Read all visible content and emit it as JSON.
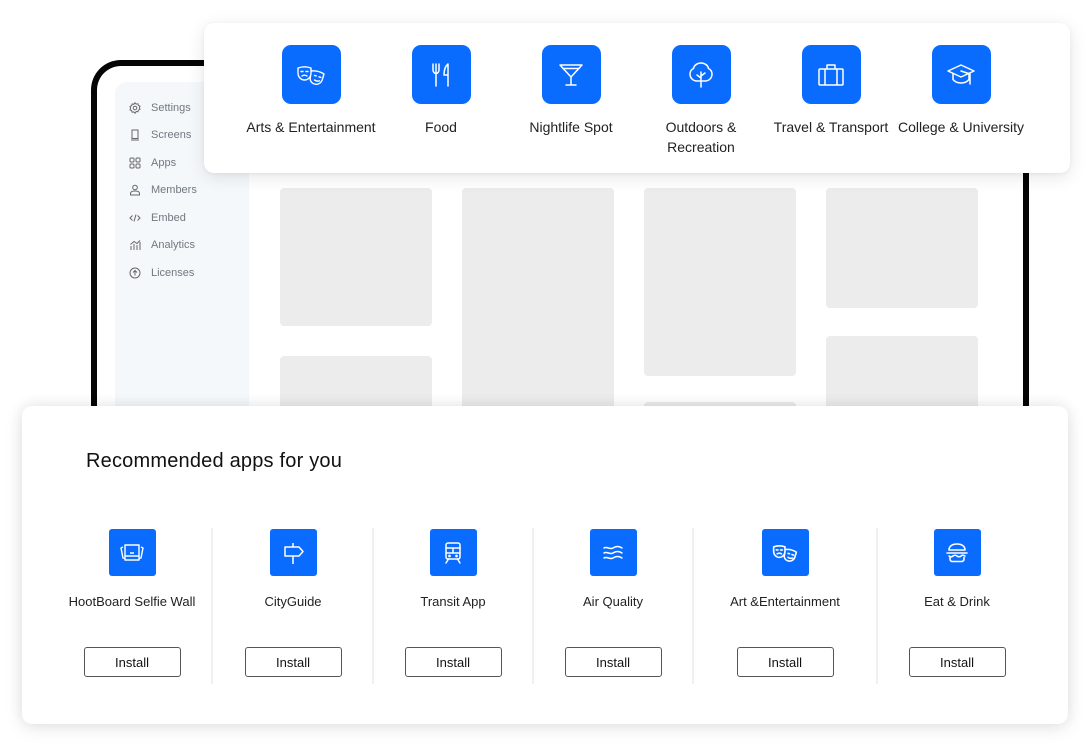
{
  "sidebar": {
    "items": [
      {
        "label": "Settings",
        "icon": "gear-icon"
      },
      {
        "label": "Screens",
        "icon": "screen-icon"
      },
      {
        "label": "Apps",
        "icon": "apps-grid-icon"
      },
      {
        "label": "Members",
        "icon": "user-icon"
      },
      {
        "label": "Embed",
        "icon": "code-icon"
      },
      {
        "label": "Analytics",
        "icon": "analytics-icon"
      },
      {
        "label": "Licenses",
        "icon": "upload-circle-icon"
      }
    ]
  },
  "categories": [
    {
      "label": "Arts & Entertainment",
      "icon": "theater-masks-icon"
    },
    {
      "label": "Food",
      "icon": "fork-knife-icon"
    },
    {
      "label": "Nightlife Spot",
      "icon": "cocktail-glass-icon"
    },
    {
      "label": "Outdoors & Recreation",
      "icon": "tree-icon"
    },
    {
      "label": "Travel & Transport",
      "icon": "suitcase-icon"
    },
    {
      "label": "College & University",
      "icon": "graduation-cap-icon"
    }
  ],
  "recommended": {
    "title": "Recommended apps for you",
    "apps": [
      {
        "name": "HootBoard Selfie Wall",
        "icon": "photo-stack-icon",
        "button": "Install"
      },
      {
        "name": "CityGuide",
        "icon": "signpost-icon",
        "button": "Install"
      },
      {
        "name": "Transit App",
        "icon": "train-icon",
        "button": "Install"
      },
      {
        "name": "Air Quality",
        "icon": "waves-icon",
        "button": "Install"
      },
      {
        "name": "Art &Entertainment",
        "icon": "theater-masks-icon",
        "button": "Install"
      },
      {
        "name": "Eat & Drink",
        "icon": "burger-icon",
        "button": "Install"
      }
    ]
  },
  "colors": {
    "accent": "#0a6cff",
    "sidebar_bg": "#f5f8fb",
    "placeholder_tile": "#ececec"
  }
}
